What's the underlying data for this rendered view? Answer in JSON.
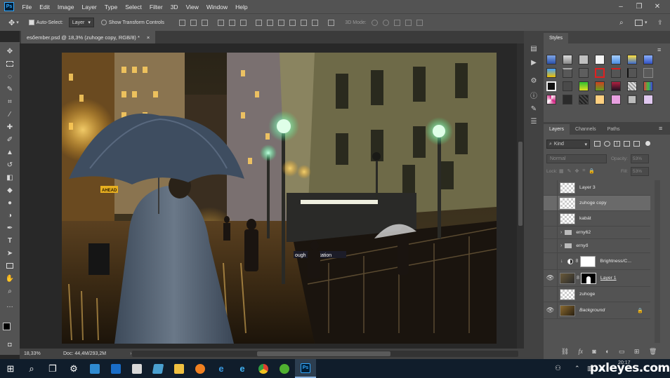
{
  "app": {
    "logo": "Ps",
    "accent": "#31a8ff"
  },
  "menu": [
    "File",
    "Edit",
    "Image",
    "Layer",
    "Type",
    "Select",
    "Filter",
    "3D",
    "View",
    "Window",
    "Help"
  ],
  "options": {
    "auto_select_label": "Auto-Select:",
    "auto_select_value": "Layer",
    "show_transform_label": "Show Transform Controls",
    "mode_3d_label": "3D Mode:"
  },
  "document": {
    "tab_title": "esőember.psd @ 18,3% (zuhoge copy, RGB/8) *",
    "tab_close": "×",
    "zoom": "18,33%",
    "doc_info": "Doc: 44,4M/293,2M"
  },
  "styles_panel": {
    "title": "Styles"
  },
  "layers_panel": {
    "tabs": [
      "Layers",
      "Channels",
      "Paths"
    ],
    "filter_kind": "Kind",
    "blend_mode": "Normal",
    "opacity_label": "Opacity:",
    "opacity_value": "53%",
    "lock_label": "Lock:",
    "fill_label": "Fill:",
    "fill_value": "53%",
    "layers": [
      {
        "name": "Layer 3",
        "visible": false,
        "type": "pixel"
      },
      {
        "name": "zuhoge copy",
        "visible": false,
        "type": "pixel",
        "selected": true
      },
      {
        "name": "kabát",
        "visible": false,
        "type": "pixel"
      },
      {
        "name": "erny62",
        "visible": false,
        "type": "group"
      },
      {
        "name": "ernyő",
        "visible": false,
        "type": "group"
      },
      {
        "name": "Brightness/C...",
        "visible": false,
        "type": "adjustment"
      },
      {
        "name": "Layer 1",
        "visible": true,
        "type": "masked"
      },
      {
        "name": "zuhoge",
        "visible": false,
        "type": "pixel"
      },
      {
        "name": "Background",
        "visible": true,
        "type": "background",
        "locked": true
      }
    ]
  },
  "canvas_scene": {
    "sign_text": "AHEAD",
    "station_text": "ough H... Station"
  },
  "taskbar": {
    "time": "20:17",
    "watermark": "pxleyes.com"
  }
}
